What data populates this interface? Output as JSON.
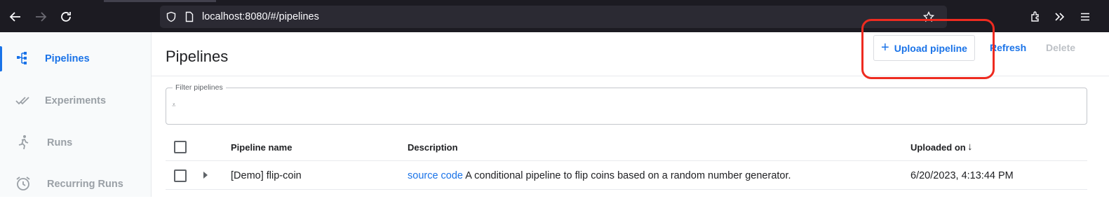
{
  "browser": {
    "url": "localhost:8080/#/pipelines"
  },
  "sidebar": {
    "items": [
      {
        "label": "Pipelines",
        "active": true
      },
      {
        "label": "Experiments",
        "active": false
      },
      {
        "label": "Runs",
        "active": false
      },
      {
        "label": "Recurring Runs",
        "active": false
      }
    ]
  },
  "main": {
    "title": "Pipelines",
    "toolbar": {
      "upload_label": "Upload pipeline",
      "upload_icon": "+",
      "refresh_label": "Refresh",
      "delete_label": "Delete"
    },
    "filter": {
      "label": "Filter pipelines",
      "value": ""
    },
    "table": {
      "columns": [
        "Pipeline name",
        "Description",
        "Uploaded on"
      ],
      "sort_indicator": "↓",
      "rows": [
        {
          "name": "[Demo] flip-coin",
          "description_link": "source code",
          "description_text": "A conditional pipeline to flip coins based on a random number generator.",
          "uploaded_on": "6/20/2023, 4:13:44 PM"
        }
      ]
    }
  },
  "colors": {
    "accent": "#1a73e8",
    "highlight": "#ee2b20",
    "chrome_bg": "#1c1b22"
  }
}
